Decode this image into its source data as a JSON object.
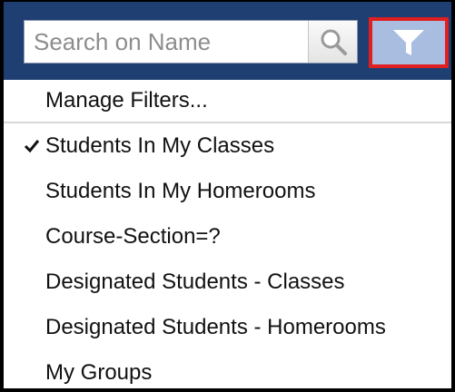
{
  "search": {
    "placeholder": "Search on Name",
    "value": "",
    "search_icon": "magnifier-icon",
    "filter_icon": "funnel-filter-icon"
  },
  "menu": {
    "manage_label": "Manage Filters...",
    "items": [
      {
        "label": "Students In My Classes",
        "checked": true
      },
      {
        "label": "Students In My Homerooms",
        "checked": false
      },
      {
        "label": "Course-Section=?",
        "checked": false
      },
      {
        "label": "Designated Students - Classes",
        "checked": false
      },
      {
        "label": "Designated Students - Homerooms",
        "checked": false
      },
      {
        "label": "My Groups",
        "checked": false
      }
    ]
  },
  "colors": {
    "header_bg": "#1f3f73",
    "filter_button_bg": "#a8bde0",
    "filter_button_border": "#e02020"
  }
}
